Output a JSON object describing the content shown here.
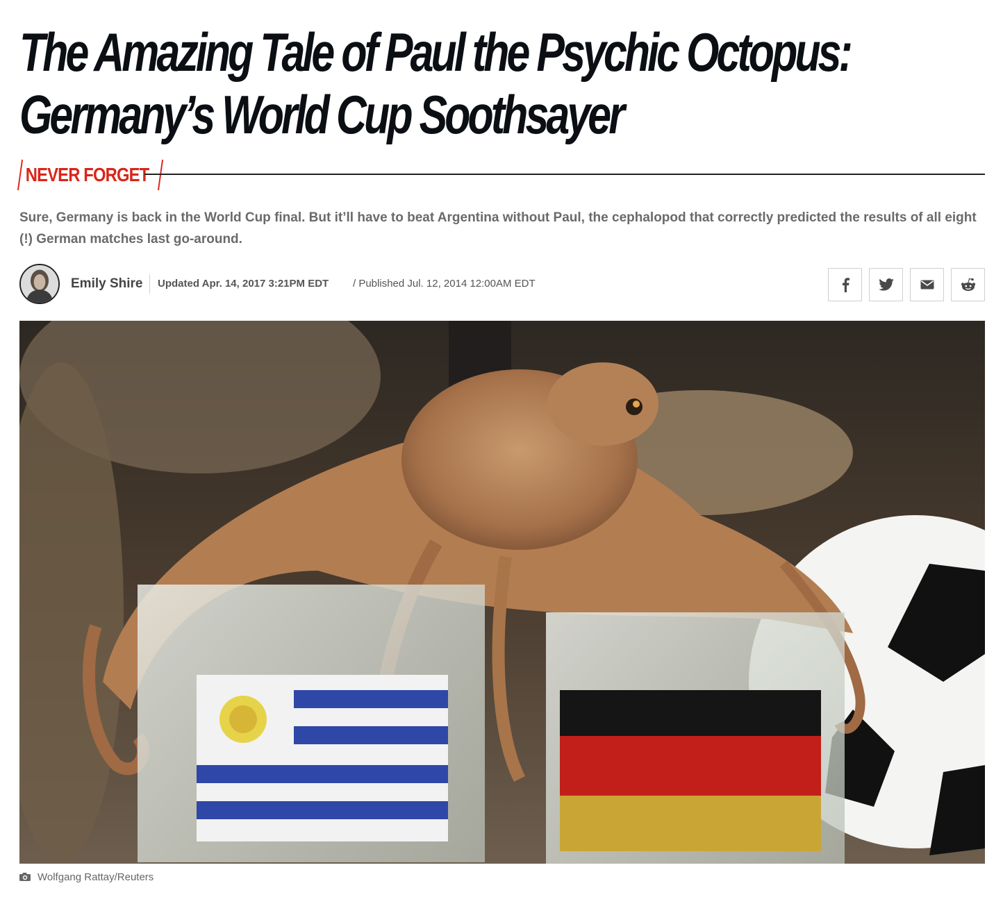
{
  "article": {
    "headline": "The Amazing Tale of Paul the Psychic Octopus: Germany’s World Cup Soothsayer",
    "kicker": "NEVER FORGET",
    "dek": "Sure, Germany is back in the World Cup final. But it’ll have to beat Argentina without Paul, the cephalopod that correctly predicted the results of all eight (!) German matches last go-around.",
    "author": "Emily Shire",
    "updated": "Updated Apr. 14, 2017 3:21PM EDT",
    "published": "/ Published Jul. 12, 2014 12:00AM EDT",
    "photo_credit": "Wolfgang Rattay/Reuters"
  },
  "share": {
    "items": [
      {
        "icon": "facebook-icon"
      },
      {
        "icon": "twitter-icon"
      },
      {
        "icon": "email-icon"
      },
      {
        "icon": "reddit-icon"
      }
    ]
  },
  "colors": {
    "headline": "#0b0f14",
    "kicker": "#d8261a",
    "dek": "#6a6a6a",
    "meta": "#555555"
  }
}
